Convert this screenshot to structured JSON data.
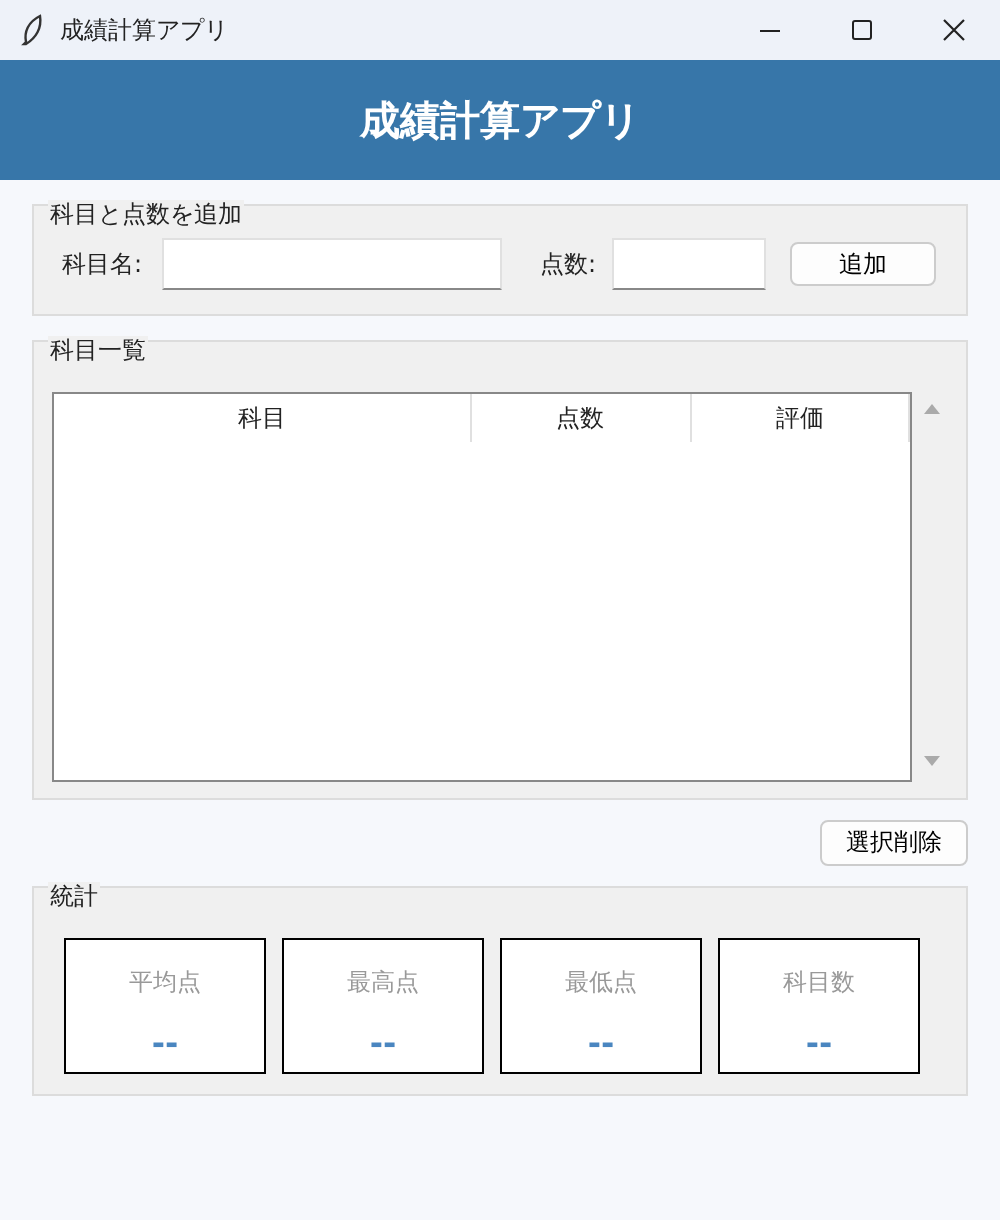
{
  "window": {
    "title": "成績計算アプリ"
  },
  "header": {
    "title": "成績計算アプリ"
  },
  "add_section": {
    "title": "科目と点数を追加",
    "subject_label": "科目名:",
    "score_label": "点数:",
    "add_button": "追加"
  },
  "list_section": {
    "title": "科目一覧",
    "columns": [
      "科目",
      "点数",
      "評価"
    ]
  },
  "delete_button": "選択削除",
  "stats_section": {
    "title": "統計",
    "cards": [
      {
        "label": "平均点",
        "value": "--"
      },
      {
        "label": "最高点",
        "value": "--"
      },
      {
        "label": "最低点",
        "value": "--"
      },
      {
        "label": "科目数",
        "value": "--"
      }
    ]
  }
}
